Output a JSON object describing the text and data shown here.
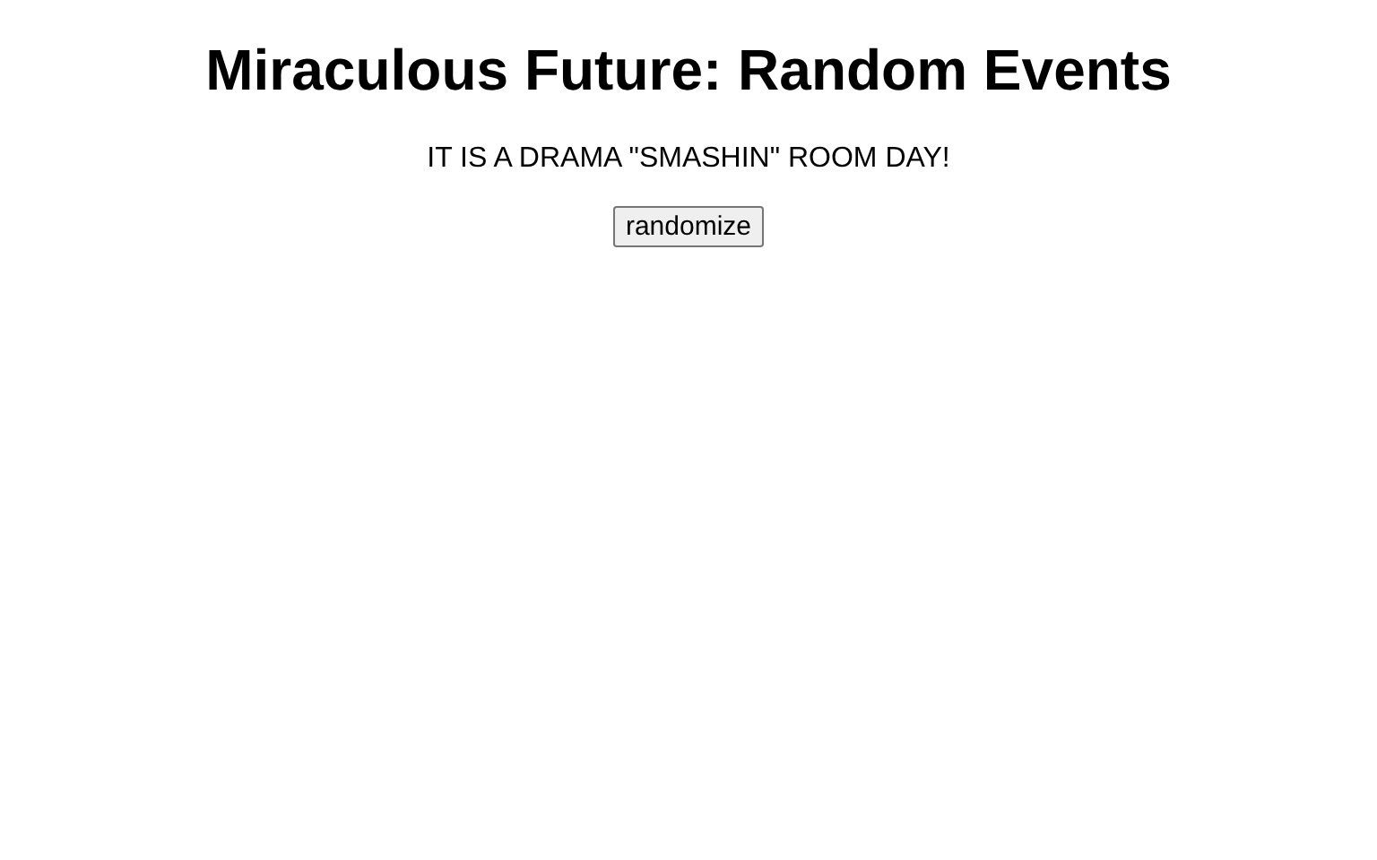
{
  "title": "Miraculous Future: Random Events",
  "event_text": "IT IS A DRAMA \"SMASHIN\" ROOM DAY!",
  "button": "randomize"
}
